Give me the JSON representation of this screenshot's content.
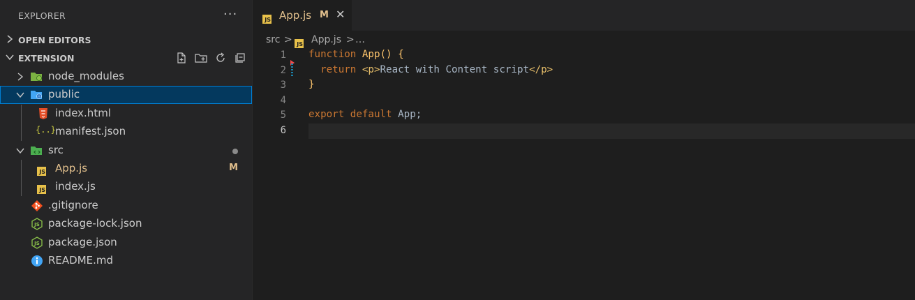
{
  "explorer": {
    "title": "EXPLORER",
    "more": "···",
    "open_editors_label": "OPEN EDITORS",
    "extension_label": "EXTENSION",
    "tree": [
      {
        "label": "node_modules",
        "icon": "folder-node-icon",
        "color": "#8c8c8c"
      },
      {
        "label": "public",
        "icon": "folder-public-icon",
        "color": "#ffffff"
      },
      {
        "label": "index.html",
        "icon": "html5-icon",
        "color": "#cccccc"
      },
      {
        "label": "manifest.json",
        "icon": "json-braces-icon",
        "color": "#cccccc"
      },
      {
        "label": "src",
        "icon": "folder-src-icon",
        "color": "#cccccc"
      },
      {
        "label": "App.js",
        "icon": "js-file-icon",
        "color": "#e2c08d",
        "badge": "M"
      },
      {
        "label": "index.js",
        "icon": "js-file-icon",
        "color": "#cccccc"
      },
      {
        "label": ".gitignore",
        "icon": "git-icon",
        "color": "#cccccc"
      },
      {
        "label": "package-lock.json",
        "icon": "nodejs-icon",
        "color": "#cccccc"
      },
      {
        "label": "package.json",
        "icon": "nodejs-icon",
        "color": "#cccccc"
      },
      {
        "label": "README.md",
        "icon": "info-icon",
        "color": "#cccccc"
      }
    ]
  },
  "tab": {
    "title": "App.js",
    "modified": "M",
    "close": "✕",
    "icon": "js-file-icon"
  },
  "breadcrumb": {
    "folder": "src",
    "sep": ">",
    "file": "App.js",
    "more": "…"
  },
  "editor": {
    "line_numbers": [
      "1",
      "2",
      "3",
      "4",
      "5",
      "6"
    ],
    "active_line": 6,
    "code": {
      "l1_kw": "function",
      "l1_fn": "App",
      "l1_rest": "() {",
      "l2_kw": "return",
      "l2_open": "<p>",
      "l2_text": "React with Content script",
      "l2_close": "</p>",
      "l3": "}",
      "l5_kw": "export default",
      "l5_rest": "App;"
    }
  },
  "colors": {
    "sidebar_bg": "#252526",
    "editor_bg": "#1e1e1e",
    "selection": "#04395e",
    "focus_border": "#007fd4",
    "modified": "#e2c08d",
    "keyword": "#cc7832",
    "function": "#ffc66d"
  }
}
